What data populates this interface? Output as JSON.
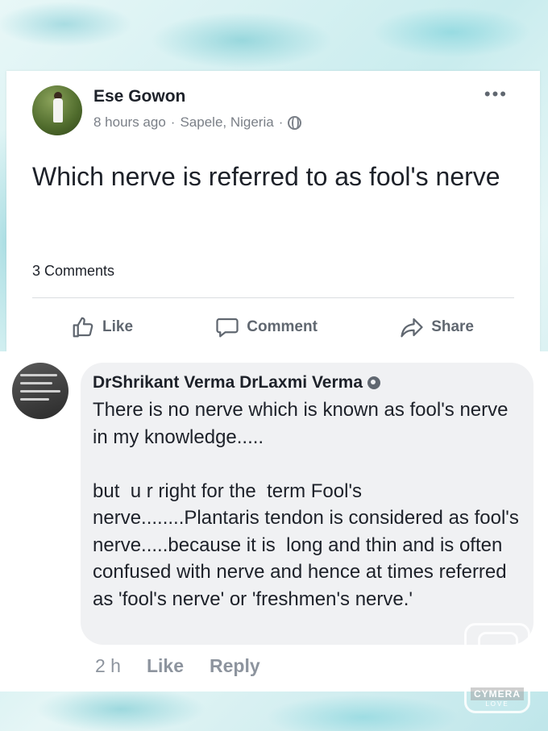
{
  "post": {
    "author": "Ese Gowon",
    "time": "8 hours ago",
    "location": "Sapele, Nigeria",
    "separator": "·",
    "more_icon": "more-horizontal-icon",
    "privacy_icon": "globe-icon",
    "text": "Which nerve is referred to as fool's nerve",
    "comment_count": "3 Comments",
    "actions": {
      "like": "Like",
      "comment": "Comment",
      "share": "Share"
    }
  },
  "comment": {
    "author": "DrShrikant Verma DrLaxmi Verma",
    "badge_icon": "top-fan-badge-icon",
    "body": "There is no nerve which is known as fool's nerve in my knowledge.....\n\nbut  u r right for the  term Fool's nerve........Plantaris tendon is considered as fool's nerve.....because it is  long and thin and is often confused with nerve and hence at times referred as 'fool's nerve' or 'freshmen's nerve.'",
    "time": "2 h",
    "like": "Like",
    "reply": "Reply"
  },
  "watermark": {
    "text": "CYMERA",
    "sub": "LOVE"
  },
  "colors": {
    "text_primary": "#1d2129",
    "text_secondary": "#606770",
    "bubble": "#f0f1f3",
    "frame": "#c9ecee"
  }
}
